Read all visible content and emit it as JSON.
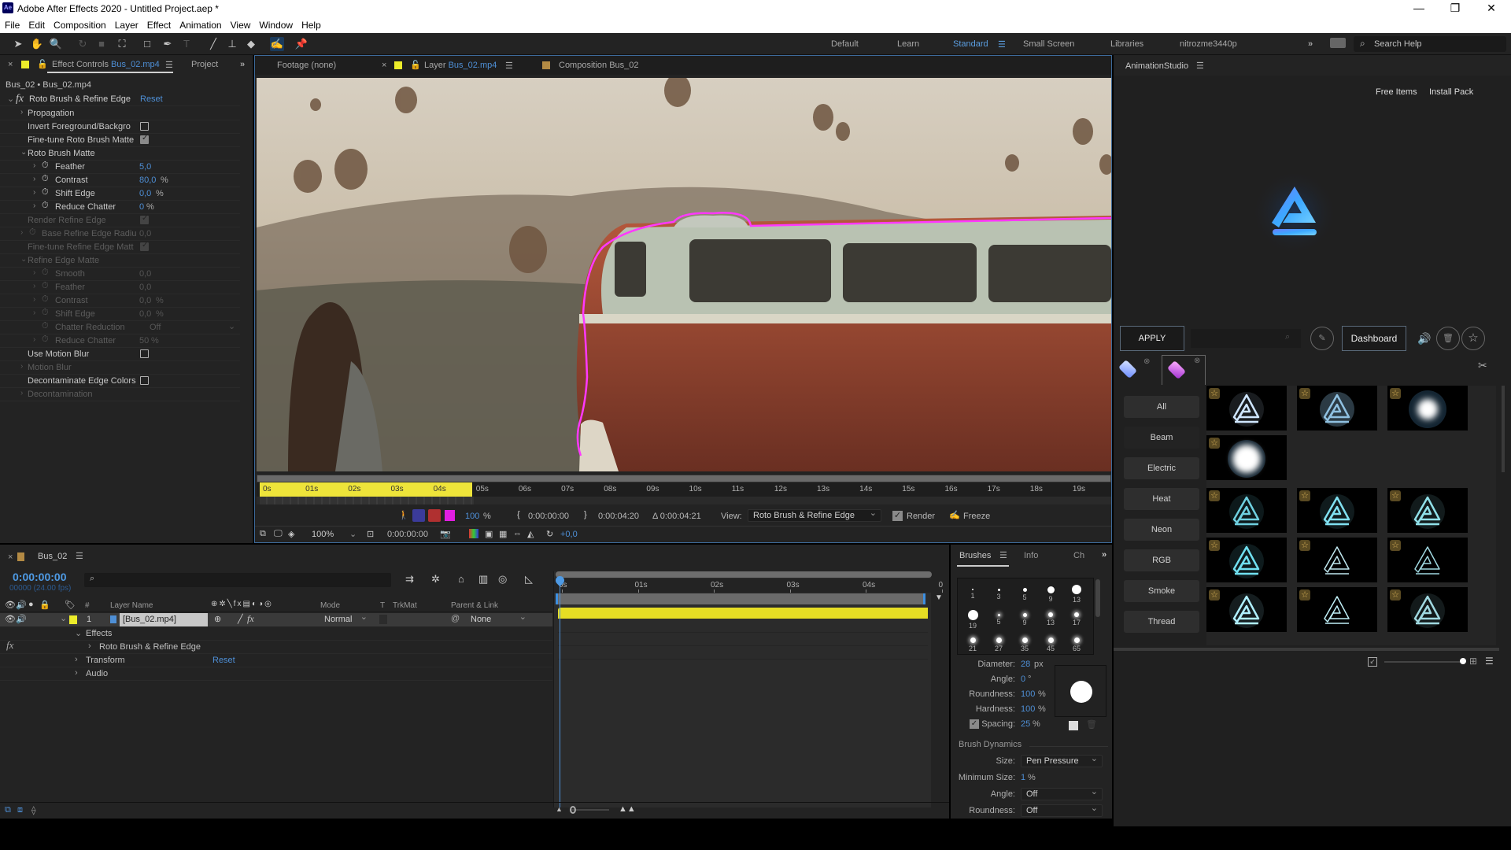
{
  "window": {
    "app_badge": "Ae",
    "title": "Adobe After Effects 2020 - Untitled Project.aep *",
    "controls": {
      "minimize": "—",
      "restore": "❐",
      "close": "✕"
    }
  },
  "menu": [
    "File",
    "Edit",
    "Composition",
    "Layer",
    "Effect",
    "Animation",
    "View",
    "Window",
    "Help"
  ],
  "toolbar": {
    "tools": [
      {
        "name": "selection-tool",
        "glyph": "➤"
      },
      {
        "name": "hand-tool",
        "glyph": "✋"
      },
      {
        "name": "zoom-tool",
        "glyph": "🔍"
      },
      {
        "name": "rotate-tool",
        "glyph": "↻"
      },
      {
        "name": "camera-tool",
        "glyph": "■"
      },
      {
        "name": "pan-behind-tool",
        "glyph": "⛶"
      },
      {
        "name": "rectangle-tool",
        "glyph": "□"
      },
      {
        "name": "pen-tool",
        "glyph": "✒"
      },
      {
        "name": "type-tool",
        "glyph": "T"
      },
      {
        "name": "brush-tool",
        "glyph": "╱"
      },
      {
        "name": "clone-stamp-tool",
        "glyph": "⊥"
      },
      {
        "name": "eraser-tool",
        "glyph": "◆"
      },
      {
        "name": "roto-brush-tool",
        "glyph": "✍"
      },
      {
        "name": "puppet-pin-tool",
        "glyph": "📌"
      }
    ],
    "workspaces": [
      "Default",
      "Learn",
      "Standard",
      "Small Screen",
      "Libraries",
      "nitrozme3440p"
    ],
    "active_workspace": "Standard",
    "overflow": "»",
    "search_placeholder": "Search Help"
  },
  "effect_controls": {
    "close": "×",
    "tab_label": "Effect Controls",
    "tab_file": "Bus_02.mp4",
    "project_tab": "Project",
    "overflow": "»",
    "breadcrumb": "Bus_02 • Bus_02.mp4",
    "effect_name": "Roto Brush & Refine Edge",
    "reset_label": "Reset",
    "rows": [
      {
        "label": "Propagation",
        "type": "group",
        "twirl": "›",
        "dim": false
      },
      {
        "label": "Invert Foreground/Backgro",
        "type": "checkbox",
        "checked": false,
        "dim": false
      },
      {
        "label": "Fine-tune Roto Brush Matte",
        "type": "checkbox",
        "checked": true,
        "dim": false
      },
      {
        "label": "Roto Brush Matte",
        "type": "group-open",
        "twirl": "⌄",
        "dim": false
      },
      {
        "label": "Feather",
        "type": "param",
        "value": "5,0",
        "unit": "",
        "dim": false
      },
      {
        "label": "Contrast",
        "type": "param",
        "value": "80,0",
        "unit": "%",
        "dim": false
      },
      {
        "label": "Shift Edge",
        "type": "param",
        "value": "0,0",
        "unit": "%",
        "dim": false
      },
      {
        "label": "Reduce Chatter",
        "type": "param",
        "value": "0",
        "unit": "%",
        "dim": false
      },
      {
        "label": "Render Refine Edge",
        "type": "checkbox",
        "checked": true,
        "dim": true
      },
      {
        "label": "Base Refine Edge Radiu",
        "type": "param-top",
        "value": "0,0",
        "unit": "",
        "dim": true
      },
      {
        "label": "Fine-tune Refine Edge Matt",
        "type": "checkbox",
        "checked": true,
        "dim": true
      },
      {
        "label": "Refine Edge Matte",
        "type": "group-open",
        "twirl": "⌄",
        "dim": true
      },
      {
        "label": "Smooth",
        "type": "param",
        "value": "0,0",
        "unit": "",
        "dim": true
      },
      {
        "label": "Feather",
        "type": "param",
        "value": "0,0",
        "unit": "",
        "dim": true
      },
      {
        "label": "Contrast",
        "type": "param",
        "value": "0,0",
        "unit": "%",
        "dim": true
      },
      {
        "label": "Shift Edge",
        "type": "param",
        "value": "0,0",
        "unit": "%",
        "dim": true
      },
      {
        "label": "Chatter Reduction",
        "type": "param-dd",
        "value": "Off",
        "unit": "",
        "dim": true
      },
      {
        "label": "Reduce Chatter",
        "type": "param",
        "value": "50",
        "unit": "%",
        "dim": true
      },
      {
        "label": "Use Motion Blur",
        "type": "checkbox",
        "checked": false,
        "dim": false
      },
      {
        "label": "Motion Blur",
        "type": "group",
        "twirl": "›",
        "dim": true
      },
      {
        "label": "Decontaminate Edge Colors",
        "type": "checkbox",
        "checked": false,
        "dim": false
      },
      {
        "label": "Decontamination",
        "type": "group",
        "twirl": "›",
        "dim": true
      }
    ]
  },
  "viewer": {
    "tabs": [
      {
        "label": "Footage (none)"
      },
      {
        "label": "Layer",
        "file": "Bus_02.mp4",
        "active": true
      },
      {
        "label": "Composition Bus_02"
      }
    ],
    "ruler_labels": [
      "0s",
      "01s",
      "02s",
      "03s",
      "04s",
      "05s",
      "06s",
      "07s",
      "08s",
      "09s",
      "10s",
      "11s",
      "12s",
      "13s",
      "14s",
      "15s",
      "16s",
      "17s",
      "18s",
      "19s"
    ],
    "roto_span_fraction": 0.25,
    "controls": {
      "opacity": "100",
      "opacity_unit": "%",
      "in_time": "0:00:00:00",
      "out_time": "0:00:04:20",
      "duration": "Δ 0:00:04:21",
      "view_label": "View:",
      "view_value": "Roto Brush & Refine Edge",
      "render_label": "Render",
      "render_checked": true,
      "freeze_label": "Freeze"
    },
    "bottom": {
      "zoom": "100%",
      "timecode": "0:00:00:00",
      "exposure": "+0,0"
    }
  },
  "timeline": {
    "close": "×",
    "comp_name": "Bus_02",
    "timecode": "0:00:00:00",
    "frame_info": "00000 (24.00 fps)",
    "search_placeholder": "",
    "columns": {
      "num": "#",
      "layer_name": "Layer Name",
      "mode": "Mode",
      "t": "T",
      "trkmat": "TrkMat",
      "parent": "Parent & Link"
    },
    "layer": {
      "index": "1",
      "name": "[Bus_02.mp4]",
      "mode": "Normal",
      "parent": "None"
    },
    "children": [
      {
        "label": "Effects",
        "twirl": "⌄",
        "indent": 1
      },
      {
        "label": "Roto Brush & Refine Edge",
        "twirl": "›",
        "indent": 2
      },
      {
        "label": "Transform",
        "twirl": "›",
        "indent": 1,
        "reset": "Reset"
      },
      {
        "label": "Audio",
        "twirl": "›",
        "indent": 1
      }
    ],
    "fx_badge": "fx",
    "ruler_labels": [
      "0s",
      "01s",
      "02s",
      "03s",
      "04s",
      "0"
    ]
  },
  "brushes": {
    "tabs": [
      "Brushes",
      "Info",
      "Ch"
    ],
    "overflow": "»",
    "presets": [
      {
        "size": "1",
        "d": 2,
        "soft": false
      },
      {
        "size": "3",
        "d": 3,
        "soft": false
      },
      {
        "size": "5",
        "d": 5,
        "soft": false
      },
      {
        "size": "9",
        "d": 9,
        "soft": false
      },
      {
        "size": "13",
        "d": 12,
        "soft": false
      },
      {
        "size": "19",
        "d": 13,
        "soft": false
      },
      {
        "size": "5",
        "d": 3,
        "soft": true
      },
      {
        "size": "9",
        "d": 5,
        "soft": true
      },
      {
        "size": "13",
        "d": 6,
        "soft": true
      },
      {
        "size": "17",
        "d": 6,
        "soft": true
      },
      {
        "size": "21",
        "d": 7,
        "soft": true
      },
      {
        "size": "27",
        "d": 7,
        "soft": true
      },
      {
        "size": "35",
        "d": 7,
        "soft": true
      },
      {
        "size": "45",
        "d": 7,
        "soft": true
      },
      {
        "size": "65",
        "d": 7,
        "soft": true
      }
    ],
    "diameter_label": "Diameter:",
    "diameter": "28",
    "diameter_unit": "px",
    "angle_label": "Angle:",
    "angle": "0",
    "angle_unit": "°",
    "roundness_label": "Roundness:",
    "roundness": "100",
    "roundness_unit": "%",
    "hardness_label": "Hardness:",
    "hardness": "100",
    "hardness_unit": "%",
    "spacing_label": "Spacing:",
    "spacing": "25",
    "spacing_unit": "%",
    "spacing_checked": true,
    "dynamics_label": "Brush Dynamics",
    "size_label": "Size:",
    "size_value": "Pen Pressure",
    "min_size_label": "Minimum Size:",
    "min_size": "1",
    "min_size_unit": "%",
    "dyn_angle_label": "Angle:",
    "dyn_angle_value": "Off",
    "dyn_roundness_label": "Roundness:",
    "dyn_roundness_value": "Off"
  },
  "animation_studio": {
    "title": "AnimationStudio",
    "free_items": "Free Items",
    "install_pack": "Install Pack",
    "apply": "APPLY",
    "search_placeholder": "",
    "dashboard": "Dashboard",
    "categories": [
      "All",
      "Beam",
      "Electric",
      "Heat",
      "Neon",
      "RGB",
      "Smoke",
      "Thread"
    ],
    "selected_category": "All",
    "pack_tabs": [
      {
        "name": "pack-blue",
        "color": "#8fb0ff"
      },
      {
        "name": "pack-purple",
        "color": "#d070f0"
      }
    ],
    "thumbnails": [
      {
        "row": 0,
        "col": 0,
        "style": "glow-outline",
        "color": "#cfe6ff"
      },
      {
        "row": 0,
        "col": 1,
        "style": "soft-glow",
        "color": "#8fc0e0"
      },
      {
        "row": 0,
        "col": 2,
        "style": "bright-glow",
        "color": "#ffffff"
      },
      {
        "row": 1,
        "col": 0,
        "style": "white-blob",
        "color": "#ffffff"
      },
      {
        "row": 2,
        "col": 0,
        "style": "neon",
        "color": "#6fd0e0"
      },
      {
        "row": 2,
        "col": 1,
        "style": "neon",
        "color": "#80e0f0"
      },
      {
        "row": 2,
        "col": 2,
        "style": "neon-soft",
        "color": "#90e0e8"
      },
      {
        "row": 3,
        "col": 0,
        "style": "electric",
        "color": "#70e0f0"
      },
      {
        "row": 3,
        "col": 1,
        "style": "thin",
        "color": "#c0e8f0"
      },
      {
        "row": 3,
        "col": 2,
        "style": "thin",
        "color": "#a0d8e0"
      },
      {
        "row": 4,
        "col": 0,
        "style": "neon",
        "color": "#b0f0ff"
      },
      {
        "row": 4,
        "col": 1,
        "style": "thin",
        "color": "#c0f0f8"
      },
      {
        "row": 4,
        "col": 2,
        "style": "smoke",
        "color": "#a0d8e0"
      },
      {
        "row": 5,
        "col": 0,
        "style": "glow-outline",
        "color": "#c0f0ff"
      },
      {
        "row": 5,
        "col": 1,
        "style": "smoke",
        "color": "#a0e0e8"
      },
      {
        "row": 5,
        "col": 2,
        "style": "glow-outline",
        "color": "#d0f0f8"
      },
      {
        "row": 6,
        "col": 0,
        "style": "electric",
        "color": "#80d0e0"
      },
      {
        "row": 6,
        "col": 1,
        "style": "bright-neon",
        "color": "#a0f0ff"
      },
      {
        "row": 6,
        "col": 2,
        "style": "neon",
        "color": "#70c8d8"
      },
      {
        "row": 7,
        "col": 0,
        "style": "smoke",
        "color": "#b0e8f0"
      },
      {
        "row": 7,
        "col": 1,
        "style": "thin",
        "color": "#c0e8f0"
      },
      {
        "row": 7,
        "col": 2,
        "style": "neon-soft",
        "color": "#3a90a8"
      }
    ],
    "thumb_size_fraction": 1.0
  }
}
